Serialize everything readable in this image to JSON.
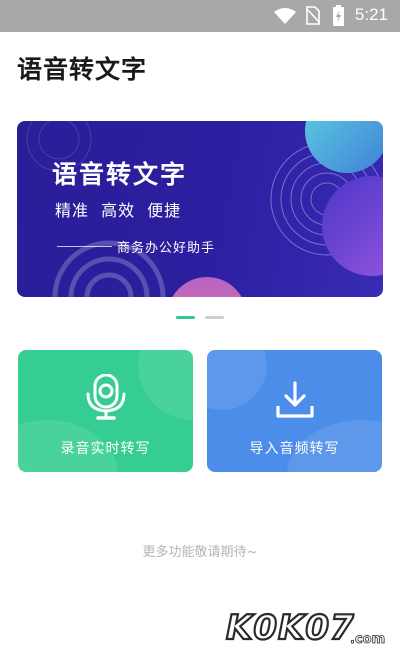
{
  "status_bar": {
    "time": "5:21",
    "icons": [
      "wifi-icon",
      "no-sim-icon",
      "battery-charging-icon"
    ]
  },
  "header": {
    "title": "语音转文字"
  },
  "banner": {
    "title": "语音转文字",
    "features": "精准 高效 便捷",
    "slogan": "商务办公好助手",
    "colors": {
      "background": "#2c1fa0",
      "accent_teal": "#4fc6d8",
      "accent_purple": "#8a4fd9"
    }
  },
  "pager": {
    "total": 2,
    "active_index": 0,
    "active_color": "#2ec98f"
  },
  "cards": [
    {
      "label": "录音实时转写",
      "icon": "microphone-icon",
      "color": "#36cd92"
    },
    {
      "label": "导入音频转写",
      "icon": "download-icon",
      "color": "#4b8de8"
    }
  ],
  "footer": {
    "more_text": "更多功能敬请期待~"
  },
  "watermark": {
    "text": "k0k07.com"
  }
}
